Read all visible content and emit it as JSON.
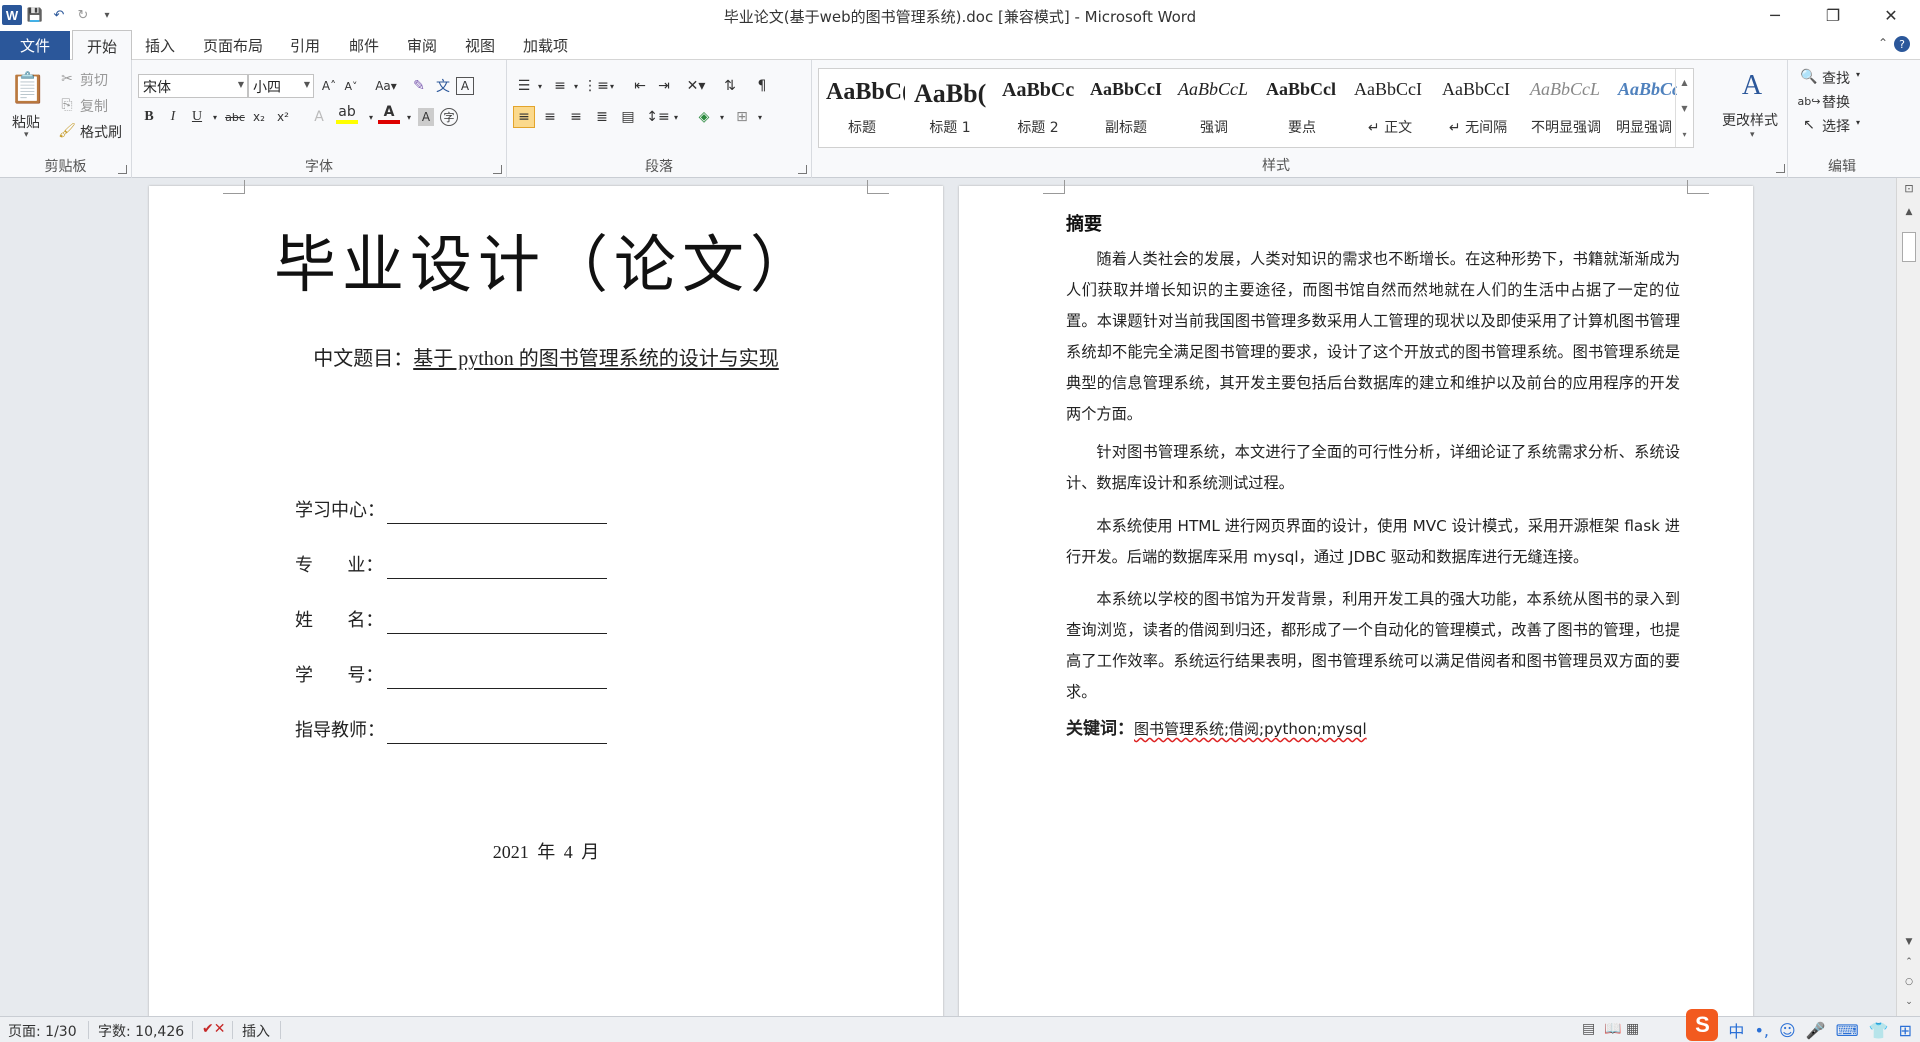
{
  "window": {
    "title": "毕业论文(基于web的图书管理系统).doc [兼容模式] - Microsoft Word",
    "app_logo": "W",
    "controls": {
      "minimize": "─",
      "restore": "❐",
      "close": "✕"
    }
  },
  "tabs": {
    "file": "文件",
    "items": [
      "开始",
      "插入",
      "页面布局",
      "引用",
      "邮件",
      "审阅",
      "视图",
      "加载项"
    ]
  },
  "ribbon": {
    "clipboard": {
      "label": "剪贴板",
      "paste": "粘贴",
      "cut": "剪切",
      "copy": "复制",
      "format_painter": "格式刷"
    },
    "font": {
      "label": "字体",
      "font_name": "宋体",
      "font_size": "小四"
    },
    "paragraph": {
      "label": "段落"
    },
    "styles": {
      "label": "样式",
      "items": [
        {
          "sample": "AaBbC(",
          "name": "标题"
        },
        {
          "sample": "AaBb(",
          "name": "标题 1"
        },
        {
          "sample": "AaBbCc",
          "name": "标题 2"
        },
        {
          "sample": "AaBbCcI",
          "name": "副标题"
        },
        {
          "sample": "AaBbCcL",
          "name": "强调"
        },
        {
          "sample": "AaBbCcl",
          "name": "要点"
        },
        {
          "sample": "AaBbCcI",
          "name": "↵ 正文"
        },
        {
          "sample": "AaBbCcI",
          "name": "↵ 无间隔"
        },
        {
          "sample": "AaBbCcL",
          "name": "不明显强调"
        },
        {
          "sample": "AaBbCcl",
          "name": "明显强调"
        }
      ],
      "change_styles": "更改样式"
    },
    "editing": {
      "label": "编辑",
      "find": "查找",
      "replace": "替换",
      "select": "选择"
    }
  },
  "page1": {
    "title": "毕业设计（论文）",
    "subtitle_label": "中文题目：",
    "subtitle_value": "基于 python 的图书管理系统的设计与实现",
    "fields": [
      "学习中心：",
      "专      业：",
      "姓      名：",
      "学      号：",
      "指导教师："
    ],
    "date": "2021 年 4 月"
  },
  "page2": {
    "heading": "摘要",
    "paragraphs": [
      "随着人类社会的发展，人类对知识的需求也不断增长。在这种形势下，书籍就渐渐成为人们获取并增长知识的主要途径，而图书馆自然而然地就在人们的生活中占据了一定的位置。本课题针对当前我国图书管理多数采用人工管理的现状以及即使采用了计算机图书管理系统却不能完全满足图书管理的要求，设计了这个开放式的图书管理系统。图书管理系统是典型的信息管理系统，其开发主要包括后台数据库的建立和维护以及前台的应用程序的开发两个方面。",
      "针对图书管理系统，本文进行了全面的可行性分析，详细论证了系统需求分析、系统设计、数据库设计和系统测试过程。",
      "本系统使用 HTML 进行网页界面的设计，使用 MVC 设计模式，采用开源框架 flask 进行开发。后端的数据库采用 mysql，通过 JDBC 驱动和数据库进行无缝连接。",
      "本系统以学校的图书馆为开发背景，利用开发工具的强大功能，本系统从图书的录入到查询浏览，读者的借阅到归还，都形成了一个自动化的管理模式，改善了图书的管理，也提高了工作效率。系统运行结果表明，图书管理系统可以满足借阅者和图书管理员双方面的要求。"
    ],
    "keywords_label": "关键词：",
    "keywords_value": "图书管理系统;借阅;python;mysql"
  },
  "status": {
    "page": "页面: 1/30",
    "words": "字数: 10,426",
    "mode": "插入"
  },
  "tray": {
    "ime": "中",
    "logo": "S"
  }
}
